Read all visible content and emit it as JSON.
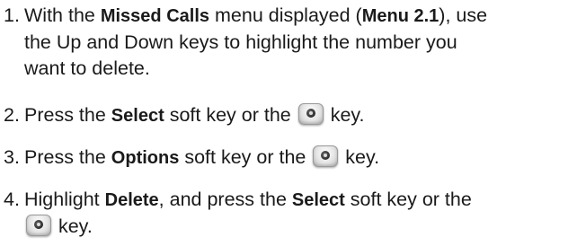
{
  "steps": [
    {
      "number": "1.",
      "lines": [
        {
          "t1": "With the ",
          "b1": "Missed Calls",
          "t2": " menu displayed (",
          "b2": "Menu 2.1",
          "t3": "), use"
        },
        "the Up and Down keys to highlight the number you",
        "want to delete."
      ]
    },
    {
      "number": "2.",
      "t1": "Press the ",
      "b1": "Select",
      "t2": " soft key or the ",
      "t3": " key."
    },
    {
      "number": "3.",
      "t1": "Press the ",
      "b1": "Options",
      "t2": " soft key or the ",
      "t3": " key."
    },
    {
      "number": "4.",
      "t1": "Highlight ",
      "b1": "Delete",
      "t2": ", and press the ",
      "b2": "Select",
      "t3": " soft key or the",
      "t4": " key."
    }
  ],
  "icons": {
    "center_key": "center-select-key-icon"
  }
}
